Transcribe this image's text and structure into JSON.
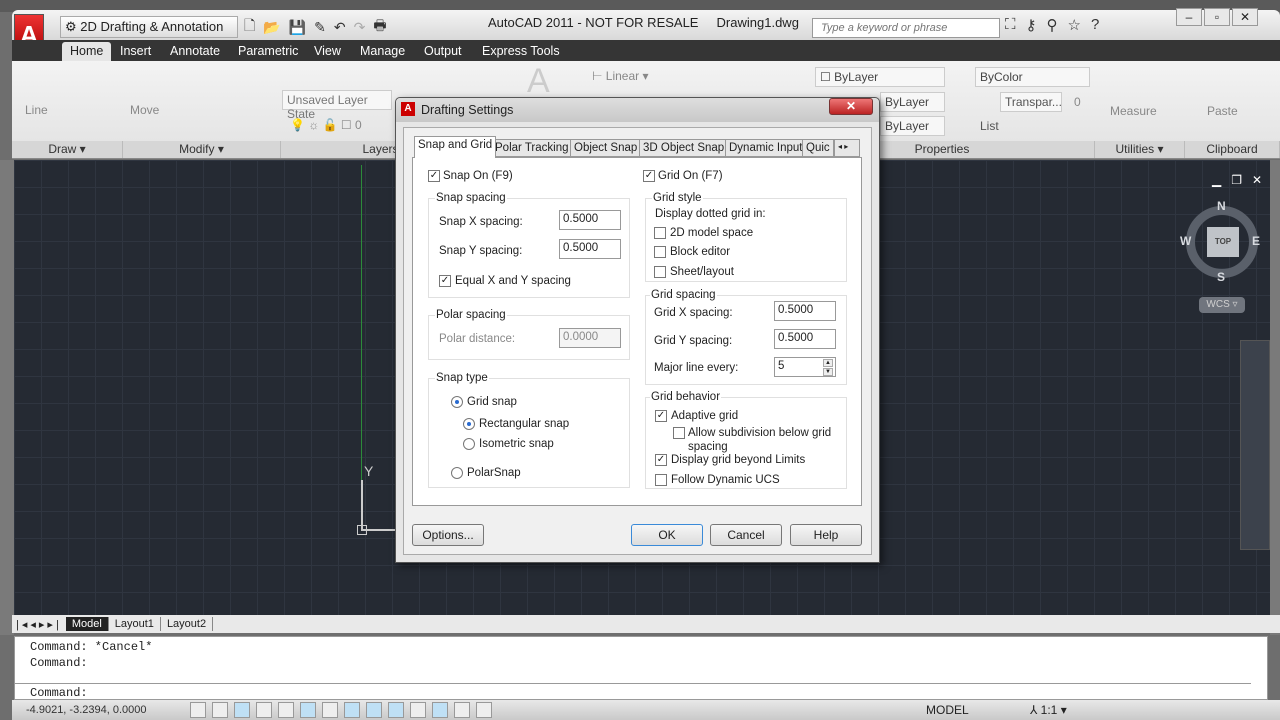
{
  "app": {
    "title": "AutoCAD 2011 - NOT FOR RESALE",
    "document": "Drawing1.dwg",
    "logo_letter": "A",
    "workspace": "2D Drafting & Annotation",
    "search_placeholder": "Type a keyword or phrase"
  },
  "ribbon": {
    "tabs": [
      "Home",
      "Insert",
      "Annotate",
      "Parametric",
      "View",
      "Manage",
      "Output",
      "Express Tools"
    ],
    "panels": [
      "Draw",
      "Modify",
      "Layers",
      "Properties",
      "Utilities",
      "Clipboard"
    ],
    "buttons": {
      "line": "Line",
      "move": "Move",
      "measure": "Measure",
      "paste": "Paste",
      "list": "List",
      "linear": "Linear"
    },
    "layer_state": "Unsaved Layer State",
    "layer_current": "0",
    "properties": {
      "color": "ByLayer",
      "linetype": "ByLayer",
      "lineweight": "ByLayer",
      "plot_style": "ByColor",
      "transparency": "Transpar...",
      "transparency_value": "0"
    }
  },
  "viewcube": {
    "n": "N",
    "s": "S",
    "e": "E",
    "w": "W",
    "top": "TOP",
    "wcs": "WCS"
  },
  "ucs": {
    "y": "Y"
  },
  "layout_tabs": [
    "Model",
    "Layout1",
    "Layout2"
  ],
  "command": {
    "lines": [
      "Command: *Cancel*",
      "Command:"
    ],
    "prompt": "Command:"
  },
  "status": {
    "coords": "-4.9021, -3.2394, 0.0000",
    "model": "MODEL",
    "scale": "1:1"
  },
  "dialog": {
    "title": "Drafting Settings",
    "tabs": [
      "Snap and Grid",
      "Polar Tracking",
      "Object Snap",
      "3D Object Snap",
      "Dynamic Input",
      "Quic"
    ],
    "snap_on": {
      "label": "Snap On (F9)",
      "checked": true
    },
    "grid_on": {
      "label": "Grid On (F7)",
      "checked": true
    },
    "snap_spacing": {
      "title": "Snap spacing",
      "x_label": "Snap X spacing:",
      "x": "0.5000",
      "y_label": "Snap Y spacing:",
      "y": "0.5000",
      "equal_label": "Equal X and Y spacing",
      "equal": true
    },
    "polar_spacing": {
      "title": "Polar spacing",
      "distance_label": "Polar distance:",
      "distance": "0.0000"
    },
    "snap_type": {
      "title": "Snap type",
      "grid_snap": "Grid snap",
      "rectangular": "Rectangular snap",
      "isometric": "Isometric snap",
      "polar": "PolarSnap"
    },
    "grid_style": {
      "title": "Grid style",
      "subtitle": "Display dotted grid in:",
      "model": "2D model space",
      "block": "Block editor",
      "sheet": "Sheet/layout"
    },
    "grid_spacing": {
      "title": "Grid spacing",
      "x_label": "Grid X spacing:",
      "x": "0.5000",
      "y_label": "Grid Y spacing:",
      "y": "0.5000",
      "major_label": "Major line every:",
      "major": "5"
    },
    "grid_behavior": {
      "title": "Grid behavior",
      "adaptive": "Adaptive grid",
      "subdivision": "Allow subdivision below grid",
      "subdivision2": "spacing",
      "beyond": "Display grid beyond Limits",
      "dynamic_ucs": "Follow Dynamic UCS"
    },
    "buttons": {
      "options": "Options...",
      "ok": "OK",
      "cancel": "Cancel",
      "help": "Help"
    }
  }
}
